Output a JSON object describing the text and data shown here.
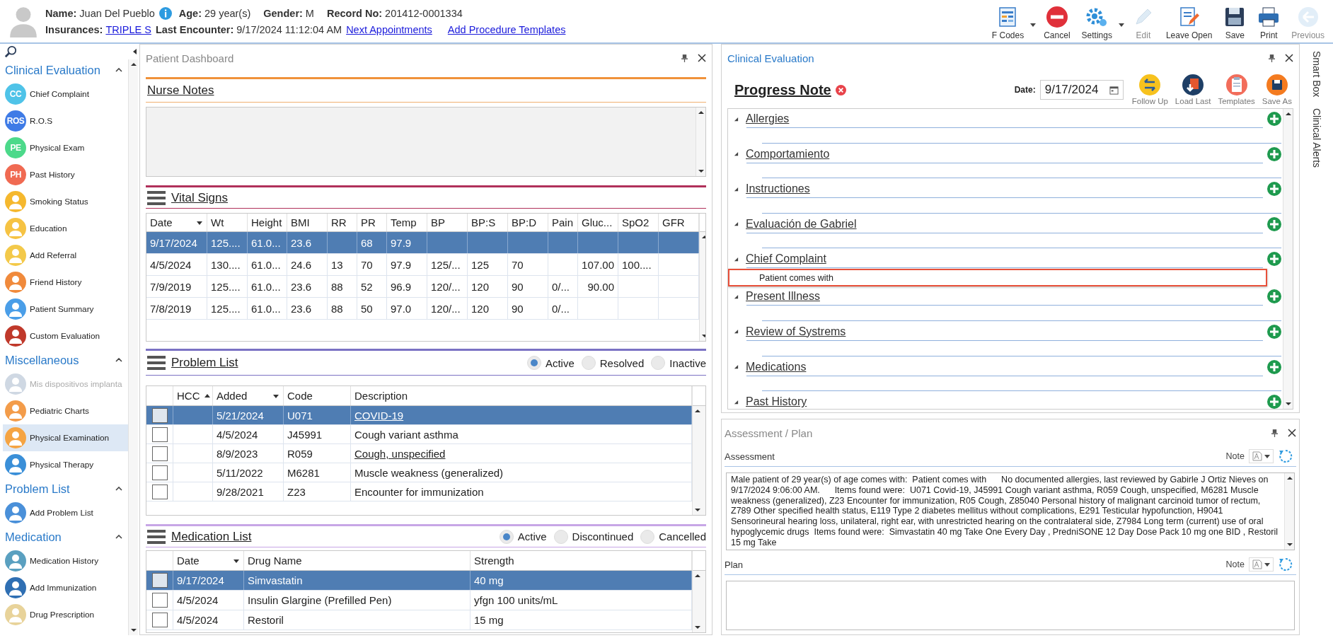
{
  "header": {
    "line_1": [
      {
        "label": "Name:",
        "value": "Juan Del Pueblo",
        "kind": "text",
        "info": true
      },
      {
        "label": "Age:",
        "value": "29 year(s)",
        "kind": "text",
        "info": false
      },
      {
        "label": "Gender:",
        "value": "M",
        "kind": "text",
        "info": false
      },
      {
        "label": "Record No:",
        "value": "201412-0001334",
        "kind": "text",
        "info": false
      }
    ],
    "line_2": [
      {
        "label": "Insurances:",
        "value": "TRIPLE S",
        "kind": "link",
        "info": false
      },
      {
        "label": "Last Encounter:",
        "value": "9/17/2024 11:12:04 AM",
        "kind": "text",
        "info": false
      }
    ],
    "links": [
      "Next Appointments",
      "Add Procedure Templates"
    ]
  },
  "toolbar": [
    {
      "label": "F Codes",
      "kind": "fcodes",
      "dropdown": true,
      "disabled": false
    },
    {
      "label": "Cancel",
      "kind": "cancel",
      "dropdown": false,
      "disabled": false
    },
    {
      "label": "Settings",
      "kind": "settings",
      "dropdown": true,
      "disabled": false
    },
    {
      "label": "Edit",
      "kind": "edit",
      "dropdown": false,
      "disabled": true
    },
    {
      "label": "Leave Open",
      "kind": "leave",
      "dropdown": false,
      "disabled": false
    },
    {
      "label": "Save",
      "kind": "save",
      "dropdown": false,
      "disabled": false
    },
    {
      "label": "Print",
      "kind": "print",
      "dropdown": false,
      "disabled": false
    },
    {
      "label": "Previous",
      "kind": "previous",
      "dropdown": false,
      "disabled": true
    }
  ],
  "sidebar": {
    "groups": [
      {
        "title": "Clinical Evaluation",
        "expanded": true,
        "items": [
          {
            "label": "Chief Complaint",
            "badge": "CC",
            "color": "#4fc3e8",
            "selected": false,
            "disabled": false
          },
          {
            "label": "R.O.S",
            "badge": "ROS",
            "color": "#3f7be6",
            "selected": false,
            "disabled": false
          },
          {
            "label": "Physical Exam",
            "badge": "PE",
            "color": "#4cd98a",
            "selected": false,
            "disabled": false
          },
          {
            "label": "Past History",
            "badge": "PH",
            "color": "#f06a52",
            "selected": false,
            "disabled": false
          },
          {
            "label": "Smoking Status",
            "color": "#f5b82e",
            "selected": false,
            "disabled": false
          },
          {
            "label": "Education",
            "color": "#f6c343",
            "selected": false,
            "disabled": false
          },
          {
            "label": "Add Referral",
            "color": "#f3c94a",
            "selected": false,
            "disabled": false
          },
          {
            "label": "Friend History",
            "color": "#f08a3c",
            "selected": false,
            "disabled": false
          },
          {
            "label": "Patient Summary",
            "color": "#4a9ee8",
            "selected": false,
            "disabled": false
          },
          {
            "label": "Custom Evaluation",
            "color": "#c0392b",
            "selected": false,
            "disabled": false
          }
        ]
      },
      {
        "title": "Miscellaneous",
        "expanded": true,
        "items": [
          {
            "label": "Mis dispositivos implanta",
            "color": "#cfd8e3",
            "selected": false,
            "disabled": true
          },
          {
            "label": "Pediatric Charts",
            "color": "#f39c4a",
            "selected": false,
            "disabled": false
          },
          {
            "label": "Physical Examination",
            "color": "#f5a443",
            "selected": true,
            "disabled": false
          },
          {
            "label": "Physical Therapy",
            "color": "#3a8fd8",
            "selected": false,
            "disabled": false
          }
        ]
      },
      {
        "title": "Problem List",
        "expanded": true,
        "items": [
          {
            "label": "Add Problem List",
            "color": "#4a90d9",
            "selected": false,
            "disabled": false
          }
        ]
      },
      {
        "title": "Medication",
        "expanded": true,
        "items": [
          {
            "label": "Medication History",
            "color": "#5aa0c0",
            "selected": false,
            "disabled": false
          },
          {
            "label": "Add Immunization",
            "color": "#2f6fb3",
            "selected": false,
            "disabled": false
          },
          {
            "label": "Drug Prescription",
            "color": "#e8d39a",
            "selected": false,
            "disabled": false
          }
        ]
      }
    ]
  },
  "dashboard": {
    "title": "Patient Dashboard",
    "nurse_notes": {
      "title": "Nurse Notes"
    },
    "vital_signs": {
      "title": "Vital Signs",
      "columns": [
        {
          "label": "Date",
          "menu": true
        },
        {
          "label": "Wt",
          "menu": false
        },
        {
          "label": "Height",
          "menu": false
        },
        {
          "label": "BMI",
          "menu": false
        },
        {
          "label": "RR",
          "menu": false
        },
        {
          "label": "PR",
          "menu": false
        },
        {
          "label": "Temp",
          "menu": false
        },
        {
          "label": "BP",
          "menu": false
        },
        {
          "label": "BP:S",
          "menu": false
        },
        {
          "label": "BP:D",
          "menu": false
        },
        {
          "label": "Pain",
          "menu": false
        },
        {
          "label": "Gluc...",
          "menu": false
        },
        {
          "label": "SpO2",
          "menu": false
        },
        {
          "label": "GFR",
          "menu": false
        }
      ],
      "rows": [
        {
          "selected": true,
          "cells": [
            "9/17/2024",
            "125....",
            "61.0...",
            "23.6",
            "",
            "68",
            "97.9",
            "",
            "",
            "",
            "",
            "",
            "",
            ""
          ]
        },
        {
          "selected": false,
          "cells": [
            "4/5/2024",
            "130....",
            "61.0...",
            "24.6",
            "13",
            "70",
            "97.9",
            "125/...",
            "125",
            "70",
            "",
            "107.00",
            "100....",
            ""
          ]
        },
        {
          "selected": false,
          "cells": [
            "7/9/2019",
            "125....",
            "61.0...",
            "23.6",
            "88",
            "52",
            "96.9",
            "120/...",
            "120",
            "90",
            "0/...",
            "90.00",
            "",
            ""
          ]
        },
        {
          "selected": false,
          "cells": [
            "7/8/2019",
            "125....",
            "61.0...",
            "23.6",
            "88",
            "50",
            "97.0",
            "120/...",
            "120",
            "90",
            "0/...",
            "",
            "",
            " "
          ]
        }
      ]
    },
    "problem_list": {
      "title": "Problem List",
      "filters": [
        {
          "label": "Active",
          "selected": true
        },
        {
          "label": "Resolved",
          "selected": false
        },
        {
          "label": "Inactive",
          "selected": false
        }
      ],
      "columns": [
        {
          "label": "HCC",
          "sorted": true,
          "menu": false
        },
        {
          "label": "Added",
          "sorted": false,
          "menu": true
        },
        {
          "label": "Code",
          "sorted": false,
          "menu": false
        },
        {
          "label": "Description",
          "sorted": false,
          "menu": false
        }
      ],
      "rows": [
        {
          "selected": true,
          "checked": false,
          "added": "5/21/2024",
          "code": "U071",
          "description": "COVID-19",
          "linked": true
        },
        {
          "selected": false,
          "checked": false,
          "added": "4/5/2024",
          "code": "J45991",
          "description": "Cough variant asthma",
          "linked": false
        },
        {
          "selected": false,
          "checked": false,
          "added": "8/9/2023",
          "code": "R059",
          "description": "Cough, unspecified",
          "linked": true
        },
        {
          "selected": false,
          "checked": false,
          "added": "5/11/2022",
          "code": "M6281",
          "description": "Muscle weakness (generalized)",
          "linked": false
        },
        {
          "selected": false,
          "checked": false,
          "added": "9/28/2021",
          "code": "Z23",
          "description": "Encounter for immunization",
          "linked": false
        }
      ]
    },
    "medication_list": {
      "title": "Medication List",
      "filters": [
        {
          "label": "Active",
          "selected": true
        },
        {
          "label": "Discontinued",
          "selected": false
        },
        {
          "label": "Cancelled",
          "selected": false
        }
      ],
      "columns": [
        {
          "label": "Date",
          "menu": true
        },
        {
          "label": "Drug Name",
          "menu": false
        },
        {
          "label": "Strength",
          "menu": false
        }
      ],
      "rows": [
        {
          "selected": true,
          "checked": false,
          "cells": [
            "9/17/2024",
            "Simvastatin",
            "40 mg"
          ]
        },
        {
          "selected": false,
          "checked": false,
          "cells": [
            "4/5/2024",
            "Insulin Glargine (Prefilled Pen)",
            "yfgn 100 units/mL"
          ]
        },
        {
          "selected": false,
          "checked": false,
          "cells": [
            "4/5/2024",
            "Restoril",
            "15 mg"
          ]
        }
      ]
    }
  },
  "clinical_evaluation": {
    "title": "Clinical Evaluation",
    "heading": "Progress Note",
    "date_label": "Date:",
    "date": "9/17/2024",
    "actions": [
      {
        "label": "Follow Up",
        "kind": "followup"
      },
      {
        "label": "Load Last",
        "kind": "loadlast"
      },
      {
        "label": "Templates",
        "kind": "templates"
      },
      {
        "label": "Save As",
        "kind": "saveas"
      }
    ],
    "sections": [
      {
        "title": "Allergies",
        "expanded": true
      },
      {
        "title": "Comportamiento",
        "expanded": true
      },
      {
        "title": "Instructiones",
        "expanded": true
      },
      {
        "title": "Evaluación de Gabriel",
        "expanded": true
      },
      {
        "title": "Chief Complaint",
        "expanded": true,
        "content": "Patient comes with",
        "highlighted": true
      },
      {
        "title": "Present Illness",
        "expanded": true
      },
      {
        "title": "Review of Systrems",
        "expanded": true
      },
      {
        "title": "Medications",
        "expanded": true
      },
      {
        "title": "Past History",
        "expanded": true
      }
    ]
  },
  "assessment_plan": {
    "title": "Assessment / Plan",
    "assessment": {
      "label": "Assessment",
      "note_label": "Note",
      "text": "Male patient of 29 year(s) of age comes with:  Patient comes with      No documented allergies, last reviewed by Gabirle J Ortiz Nieves on 9/17/2024 9:06:00 AM.      Items found were:  U071 Covid-19, J45991 Cough variant asthma, R059 Cough, unspecified, M6281 Muscle weakness (generalized), Z23 Encounter for immunization, R05 Cough, Z85040 Personal history of malignant carcinoid tumor of rectum, Z789 Other specified health status, E119 Type 2 diabetes mellitus without complications, E291 Testicular hypofunction, H9041 Sensorineural hearing loss, unilateral, right ear, with unrestricted hearing on the contralateral side, Z7984 Long term (current) use of oral hypoglycemic drugs  Items found were:  Simvastatin 40 mg Take One Every Day , PredniSONE 12 Day Dose Pack 10 mg one BID , Restoril 15 mg Take"
    },
    "plan": {
      "label": "Plan",
      "note_label": "Note"
    }
  },
  "side_tabs": [
    "Smart Box",
    "Clinical Alerts"
  ]
}
